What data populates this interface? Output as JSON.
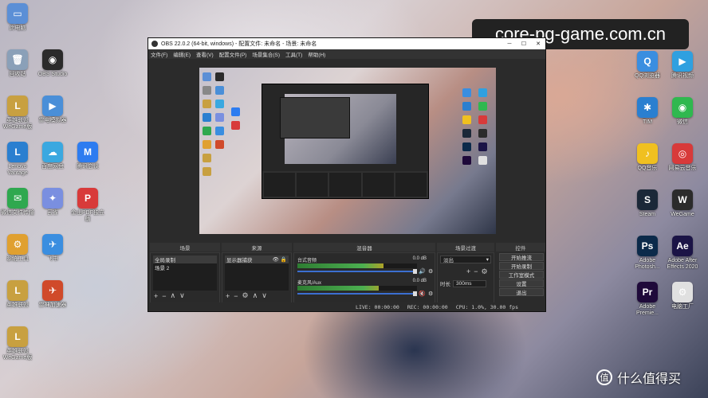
{
  "watermark": "core-pg-game.com.cn",
  "brand": {
    "logo": "值",
    "text": "什么值得买"
  },
  "desktop_icons": {
    "left": [
      {
        "label": "此电脑",
        "color": "#5b8fd6",
        "glyph": "▭"
      },
      {
        "label": "回收站",
        "color": "#8aa0b8",
        "glyph": "🗑"
      },
      {
        "label": "OBS Studio",
        "color": "#2b2b2b",
        "glyph": "◉"
      },
      {
        "label": "英雄联盟WeGame版",
        "color": "#c8a040",
        "glyph": "L"
      },
      {
        "label": "雷电模拟器",
        "color": "#4a8fd8",
        "glyph": "▶"
      },
      {
        "label": "Lenovo Vantage",
        "color": "#2a7fd0",
        "glyph": "L"
      },
      {
        "label": "百度网盘",
        "color": "#3aa8e0",
        "glyph": "☁"
      },
      {
        "label": "腾讯会议",
        "color": "#2d7cf0",
        "glyph": "M"
      },
      {
        "label": "微信文件传输",
        "color": "#2fa84f",
        "glyph": "✉"
      },
      {
        "label": "云雀",
        "color": "#7a8fe0",
        "glyph": "✦"
      },
      {
        "label": "金山PDF独立版",
        "color": "#d83a3a",
        "glyph": "P"
      },
      {
        "label": "系统工具",
        "color": "#e0a030",
        "glyph": "⚙"
      },
      {
        "label": "飞书",
        "color": "#3a8ee0",
        "glyph": "✈"
      },
      {
        "label": "英雄联盟",
        "color": "#c8a040",
        "glyph": "L"
      },
      {
        "label": "雷神加速器",
        "color": "#d04a2a",
        "glyph": "✈"
      },
      {
        "label": "英雄联盟WeGame版",
        "color": "#c8a040",
        "glyph": "L"
      }
    ],
    "right": [
      {
        "label": "QQ浏览器",
        "color": "#3a8ee0",
        "glyph": "Q"
      },
      {
        "label": "腾讯视频",
        "color": "#2fa0e0",
        "glyph": "▶"
      },
      {
        "label": "TIM",
        "color": "#2a7fd0",
        "glyph": "✱"
      },
      {
        "label": "微信",
        "color": "#2fb84f",
        "glyph": "◉"
      },
      {
        "label": "QQ音乐",
        "color": "#f0c020",
        "glyph": "♪"
      },
      {
        "label": "网易云音乐",
        "color": "#d83a3a",
        "glyph": "◎"
      },
      {
        "label": "Steam",
        "color": "#1b2838",
        "glyph": "S"
      },
      {
        "label": "WeGame",
        "color": "#2b2b2b",
        "glyph": "W"
      },
      {
        "label": "Adobe Photosh...",
        "color": "#0b2a4a",
        "glyph": "Ps"
      },
      {
        "label": "Adobe After Effects 2020",
        "color": "#1b1446",
        "glyph": "Ae"
      },
      {
        "label": "Adobe Premie...",
        "color": "#1f0a3a",
        "glyph": "Pr"
      },
      {
        "label": "电脑工厂",
        "color": "#e0e0e0",
        "glyph": "⚙"
      }
    ]
  },
  "obs": {
    "title": "OBS 22.0.2 (64-bit, windows) - 配置文件: 未命名 - 场景: 未命名",
    "menu": [
      "文件(F)",
      "编辑(E)",
      "查看(V)",
      "配置文件(P)",
      "场景集合(S)",
      "工具(T)",
      "帮助(H)"
    ],
    "headers": {
      "scenes": "场景",
      "sources": "来源",
      "mixer": "混音器",
      "transitions": "场景过渡",
      "controls": "控件"
    },
    "scenes": [
      "全局录制",
      "场景 2"
    ],
    "sources": [
      {
        "name": "显示器捕获"
      }
    ],
    "mixer": [
      {
        "name": "台式音频",
        "db": "0.0 dB",
        "level": 0.72,
        "muted": false
      },
      {
        "name": "麦克风/Aux",
        "db": "0.0 dB",
        "level": 0.68,
        "muted": true
      }
    ],
    "transitions": {
      "selected": "淡出",
      "duration_label": "时长",
      "duration_value": "300ms"
    },
    "controls": [
      "开始推流",
      "开始录制",
      "工作室模式",
      "设置",
      "退出"
    ],
    "status": {
      "live": "LIVE: 00:00:00",
      "rec": "REC: 00:00:00",
      "cpu": "CPU: 1.0%, 30.00 fps"
    }
  }
}
